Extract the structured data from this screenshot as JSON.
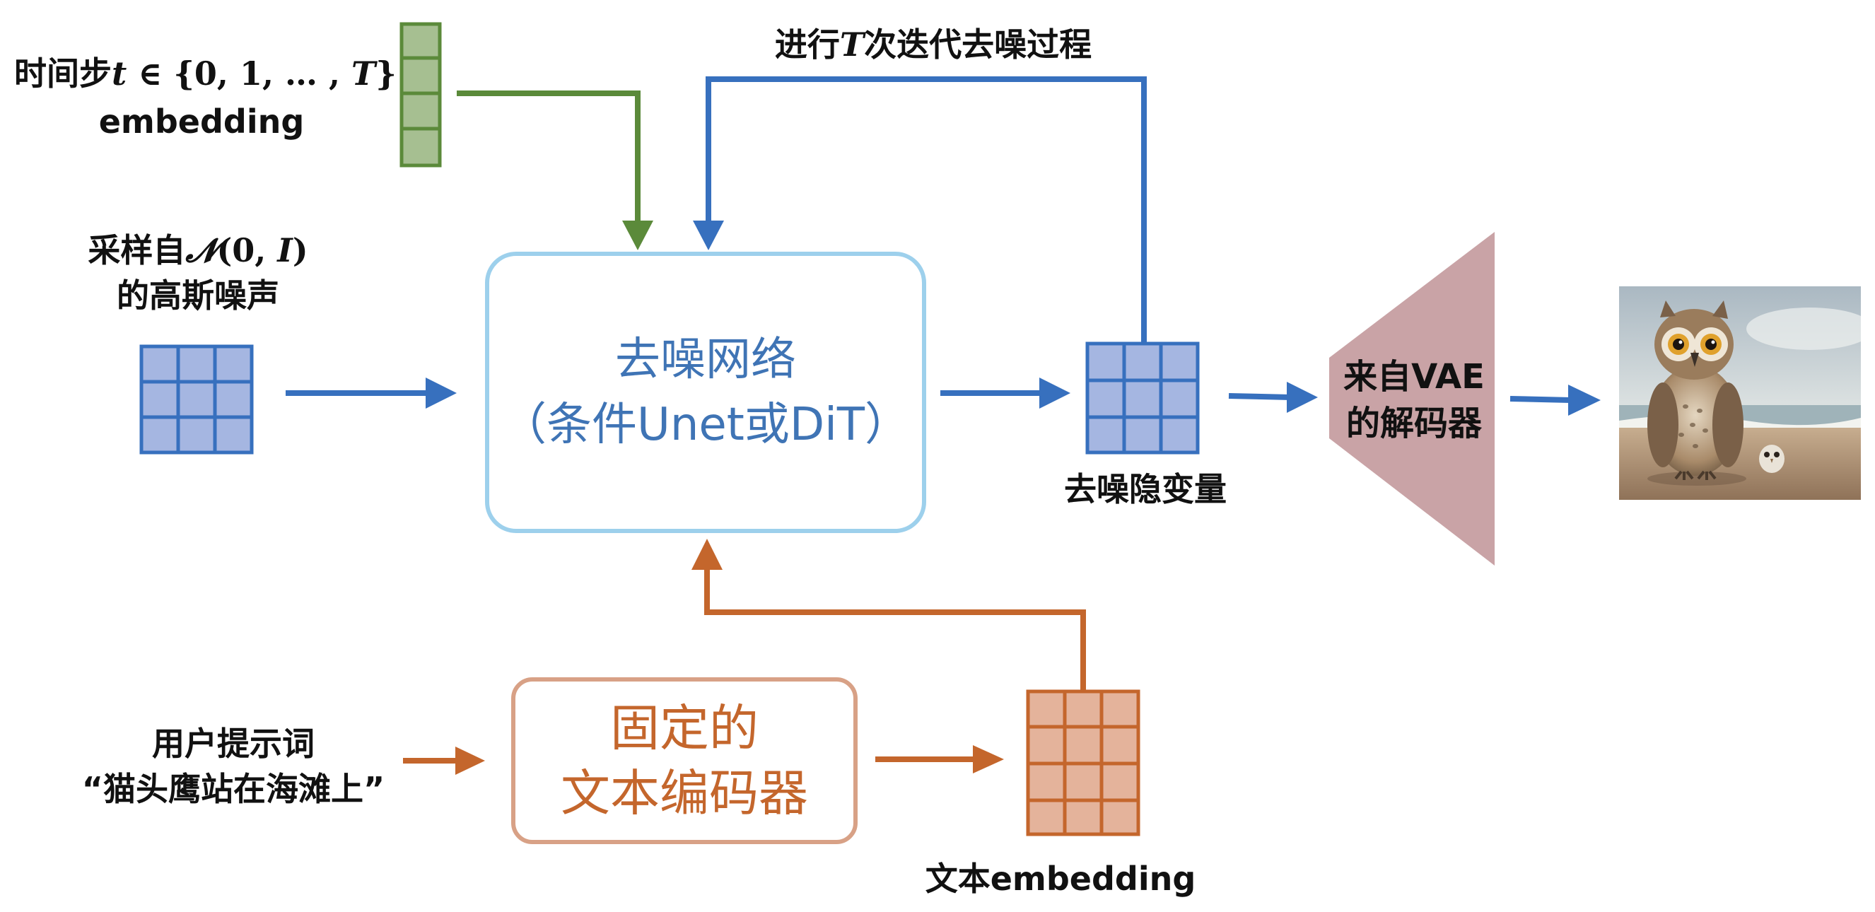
{
  "labels": {
    "time_step_prefix": "时间步",
    "time_step_var": "t",
    "time_step_set": " ∈ {0, 1, … , ",
    "time_step_T": "T",
    "time_step_close": "}",
    "time_embedding": "embedding",
    "noise_line1_prefix": "采样自",
    "noise_dist": "𝓝",
    "noise_args_open": "(",
    "noise_zero": "0",
    "noise_sep": ", ",
    "noise_I": "I",
    "noise_args_close": ")",
    "noise_line2": "的高斯噪声",
    "loop_prefix": "进行",
    "loop_T": "T",
    "loop_suffix": "次迭代去噪过程",
    "denoise_line1": "去噪网络",
    "denoise_line2": "（条件Unet或DiT）",
    "latent": "去噪隐变量",
    "vae_line1": "来自VAE",
    "vae_line2": "的解码器",
    "prompt_line1": "用户提示词",
    "prompt_line2": "“猫头鹰站在海滩上”",
    "encoder_line1": "固定的",
    "encoder_line2": "文本编码器",
    "text_embedding": "文本embedding"
  },
  "colors": {
    "green_fill": "#a6bf91",
    "green_stroke": "#5b8a3a",
    "blue_fill": "#a5b6e1",
    "blue_stroke": "#3770be",
    "box_border": "#9dd0ec",
    "box_text": "#3f74b5",
    "orange_fill": "#e4b39b",
    "orange_stroke": "#c4662c",
    "encoder_border": "#d8a186",
    "decoder_fill": "#c9a3a6"
  },
  "image": {
    "subject": "owl-on-beach"
  }
}
